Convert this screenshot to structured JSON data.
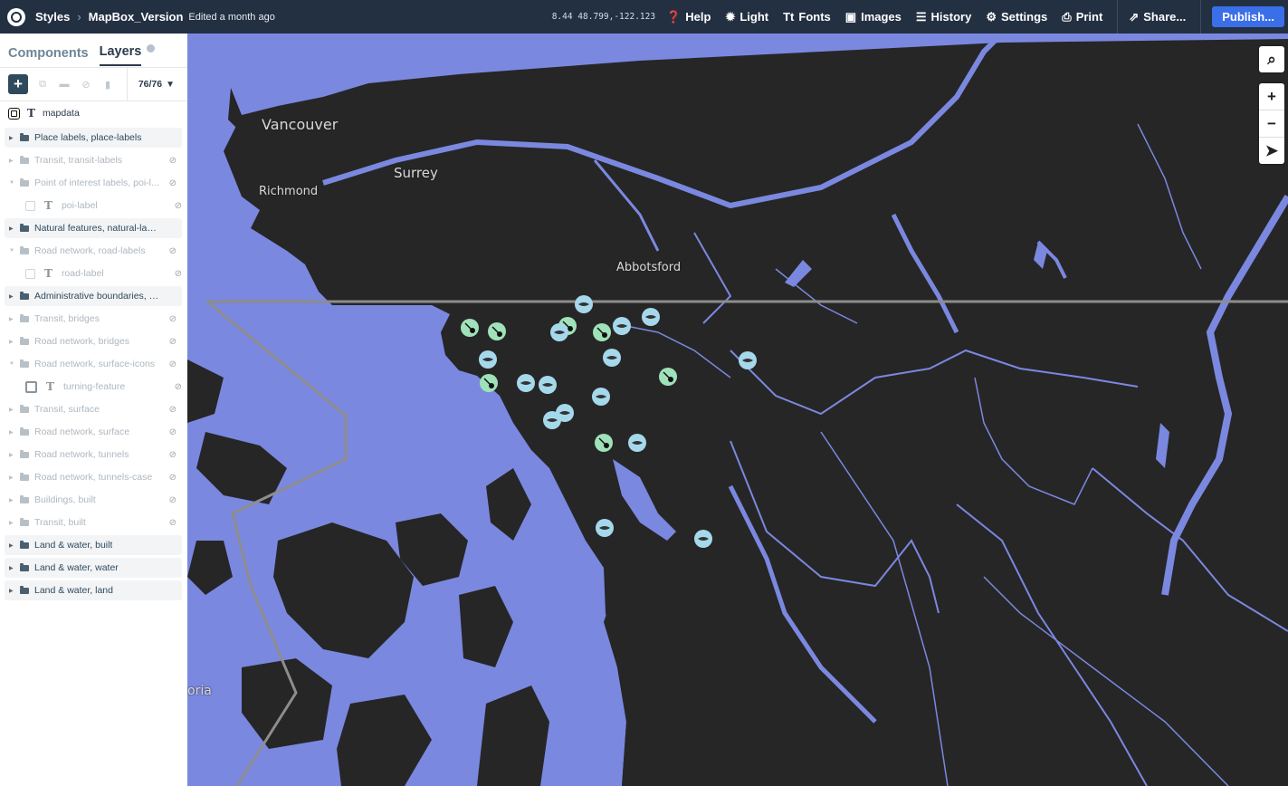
{
  "topbar": {
    "styles_label": "Styles",
    "style_name": "MapBox_Version",
    "edited": "Edited a month ago",
    "coords": "8.44 48.799,-122.123",
    "help": "Help",
    "light": "Light",
    "fonts": "Fonts",
    "images": "Images",
    "history": "History",
    "settings": "Settings",
    "print": "Print",
    "share": "Share...",
    "publish": "Publish..."
  },
  "sidebar": {
    "tabs": [
      "Components",
      "Layers"
    ],
    "layer_count": "76/76",
    "source": "mapdata",
    "layers": [
      {
        "label": "Place labels, place-labels",
        "hidden": false
      },
      {
        "label": "Transit, transit-labels",
        "hidden": true
      },
      {
        "label": "Point of interest labels, poi-l...",
        "hidden": true,
        "expanded": true,
        "child": "poi-label"
      },
      {
        "label": "Natural features, natural-labels",
        "hidden": false
      },
      {
        "label": "Road network, road-labels",
        "hidden": true,
        "expanded": true,
        "child": "road-label"
      },
      {
        "label": "Administrative boundaries, ad...",
        "hidden": false
      },
      {
        "label": "Transit, bridges",
        "hidden": true
      },
      {
        "label": "Road network, bridges",
        "hidden": true
      },
      {
        "label": "Road network, surface-icons",
        "hidden": true,
        "expanded": true,
        "child": "turning-feature"
      },
      {
        "label": "Transit, surface",
        "hidden": true
      },
      {
        "label": "Road network, surface",
        "hidden": true
      },
      {
        "label": "Road network, tunnels",
        "hidden": true
      },
      {
        "label": "Road network, tunnels-case",
        "hidden": true
      },
      {
        "label": "Buildings, built",
        "hidden": true
      },
      {
        "label": "Transit, built",
        "hidden": true
      },
      {
        "label": "Land & water, built",
        "hidden": false
      },
      {
        "label": "Land & water, water",
        "hidden": false
      },
      {
        "label": "Land & water, land",
        "hidden": false
      }
    ]
  },
  "map": {
    "places": [
      "Vancouver",
      "Surrey",
      "Richmond",
      "Abbotsford",
      "oria"
    ],
    "colors": {
      "land": "#262626",
      "water": "#7b88e0",
      "marker_fish": "#a6d8ec",
      "marker_shovel": "#9fe2b9"
    }
  }
}
